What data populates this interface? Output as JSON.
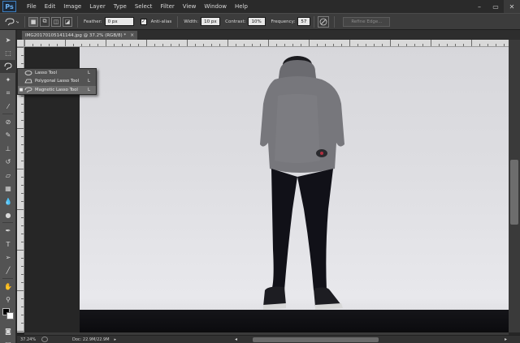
{
  "app": {
    "logo": "Ps"
  },
  "menu": [
    "File",
    "Edit",
    "Image",
    "Layer",
    "Type",
    "Select",
    "Filter",
    "View",
    "Window",
    "Help"
  ],
  "window_controls": {
    "minimize": "–",
    "restore": "▭",
    "close": "✕"
  },
  "options_bar": {
    "feather_label": "Feather:",
    "feather_value": "0 px",
    "antialias_label": "Anti-alias",
    "antialias_checked": "✓",
    "width_label": "Width:",
    "width_value": "10 px",
    "contrast_label": "Contrast:",
    "contrast_value": "10%",
    "frequency_label": "Frequency:",
    "frequency_value": "57",
    "refine_edge_label": "Refine Edge..."
  },
  "document": {
    "tab_title": "IMG20170105141144.jpg @ 37.2% (RGB/8) *",
    "tab_close": "×"
  },
  "tool_flyout": {
    "items": [
      {
        "label": "Lasso Tool",
        "shortcut": "L",
        "icon": "lasso-icon",
        "selected": false
      },
      {
        "label": "Polygonal Lasso Tool",
        "shortcut": "L",
        "icon": "polygonal-lasso-icon",
        "selected": false
      },
      {
        "label": "Magnetic Lasso Tool",
        "shortcut": "L",
        "icon": "magnetic-lasso-icon",
        "selected": true
      }
    ]
  },
  "status_bar": {
    "zoom": "37.24%",
    "doc_size": "Doc: 22.9M/22.9M",
    "arrow": "▸",
    "scroll_left": "◂",
    "scroll_right": "▸"
  },
  "colors": {
    "foreground": "#000000",
    "background": "#ffffff",
    "accent": "#3d7fc1"
  }
}
